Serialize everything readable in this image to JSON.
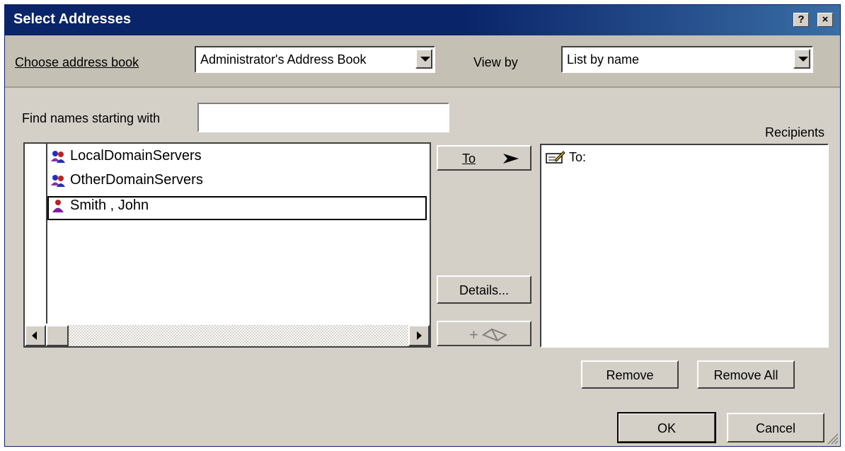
{
  "window": {
    "title": "Select Addresses",
    "help_glyph": "?",
    "close_glyph": "×"
  },
  "address_book": {
    "label": "Choose address book",
    "selected": "Administrator's Address Book",
    "viewby_label": "View by",
    "viewby_selected": "List by name"
  },
  "find": {
    "label": "Find names starting with",
    "value": ""
  },
  "names_list": {
    "items": [
      {
        "name": "LocalDomainServers",
        "icon": "group-icon"
      },
      {
        "name": "OtherDomainServers",
        "icon": "group-icon"
      },
      {
        "name": "Smith , John",
        "icon": "person-icon"
      }
    ],
    "selected_index": 2
  },
  "buttons": {
    "to": "To",
    "details": "Details...",
    "add_address": "+",
    "remove": "Remove",
    "remove_all": "Remove All",
    "ok": "OK",
    "cancel": "Cancel"
  },
  "recipients": {
    "label": "Recipients",
    "entries": [
      {
        "label": "To:",
        "icon": "memo-icon"
      }
    ]
  },
  "colors": {
    "title_bar": "#0a246a",
    "face": "#d4d0c8",
    "selection_text": "#000000"
  }
}
